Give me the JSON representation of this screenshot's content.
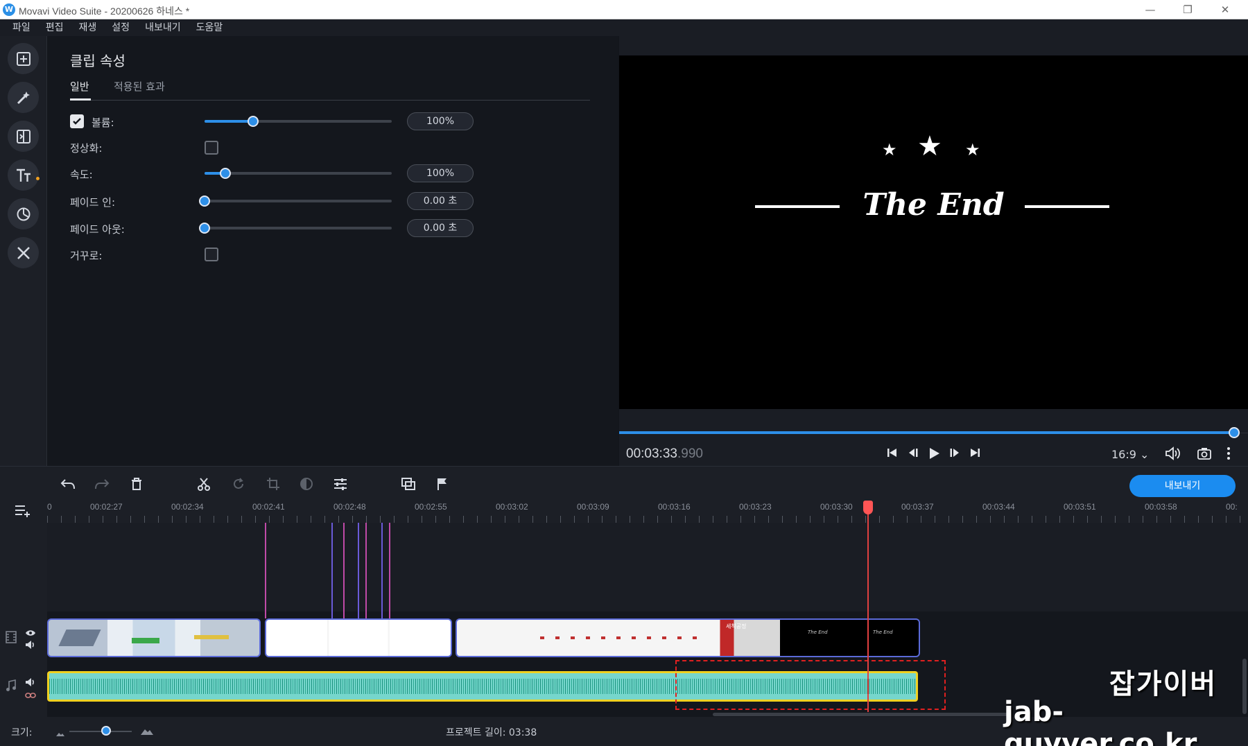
{
  "window": {
    "title": "Movavi Video Suite - 20200626 하네스 *",
    "logo": "W",
    "minimize": "—",
    "restore": "❐",
    "close": "✕"
  },
  "menu": [
    "파일",
    "편집",
    "재생",
    "설정",
    "내보내기",
    "도움말"
  ],
  "rail": {
    "icons": [
      "import-icon",
      "magic-wand-icon",
      "transitions-icon",
      "titles-icon",
      "stickers-icon",
      "tools-icon"
    ]
  },
  "properties": {
    "title": "클립 속성",
    "tabs": [
      {
        "label": "일반",
        "active": true
      },
      {
        "label": "적용된 효과",
        "active": false
      }
    ],
    "volume": {
      "label": "볼륨:",
      "checked": true,
      "value": "100%",
      "level": 0.26
    },
    "normalize": {
      "label": "정상화:",
      "checked": false
    },
    "speed": {
      "label": "속도:",
      "value": "100%",
      "level": 0.11
    },
    "fade_in": {
      "label": "페이드 인:",
      "value": "0.00 초",
      "level": 0.0
    },
    "fade_out": {
      "label": "페이드 아웃:",
      "value": "0.00 초",
      "level": 0.0
    },
    "reverse": {
      "label": "거꾸로:",
      "checked": false
    }
  },
  "preview": {
    "text": "The End",
    "timecode_main": "00:03:33",
    "timecode_ms": ".990",
    "ratio": "16:9 ⌄",
    "progress": 1.0
  },
  "toolbar": {
    "export_label": "내보내기",
    "icons": [
      "undo-icon",
      "redo-icon",
      "delete-icon",
      "cut-icon",
      "rotate-icon",
      "crop-icon",
      "color-icon",
      "adjust-icon",
      "overlay-icon",
      "marker-flag-icon"
    ]
  },
  "ruler": {
    "labels": [
      "0",
      "00:02:27",
      "00:02:34",
      "00:02:41",
      "00:02:48",
      "00:02:55",
      "00:03:02",
      "00:03:09",
      "00:03:16",
      "00:03:23",
      "00:03:30",
      "00:03:37",
      "00:03:44",
      "00:03:51",
      "00:03:58",
      "00:"
    ]
  },
  "clip_thumbs": {
    "thumb_1": "The End",
    "thumb_2": "The End",
    "red_label": "세척공정"
  },
  "status": {
    "size_label": "크기:",
    "project_length": "프로젝트 길이: 03:38"
  },
  "watermark": {
    "line1": "잡가이버",
    "line2": "jab-guyver.co.kr"
  },
  "colors": {
    "accent": "#1b8cf0",
    "playhead": "#e04040",
    "audio": "#76d6cc",
    "audio_border": "#f0d020"
  }
}
